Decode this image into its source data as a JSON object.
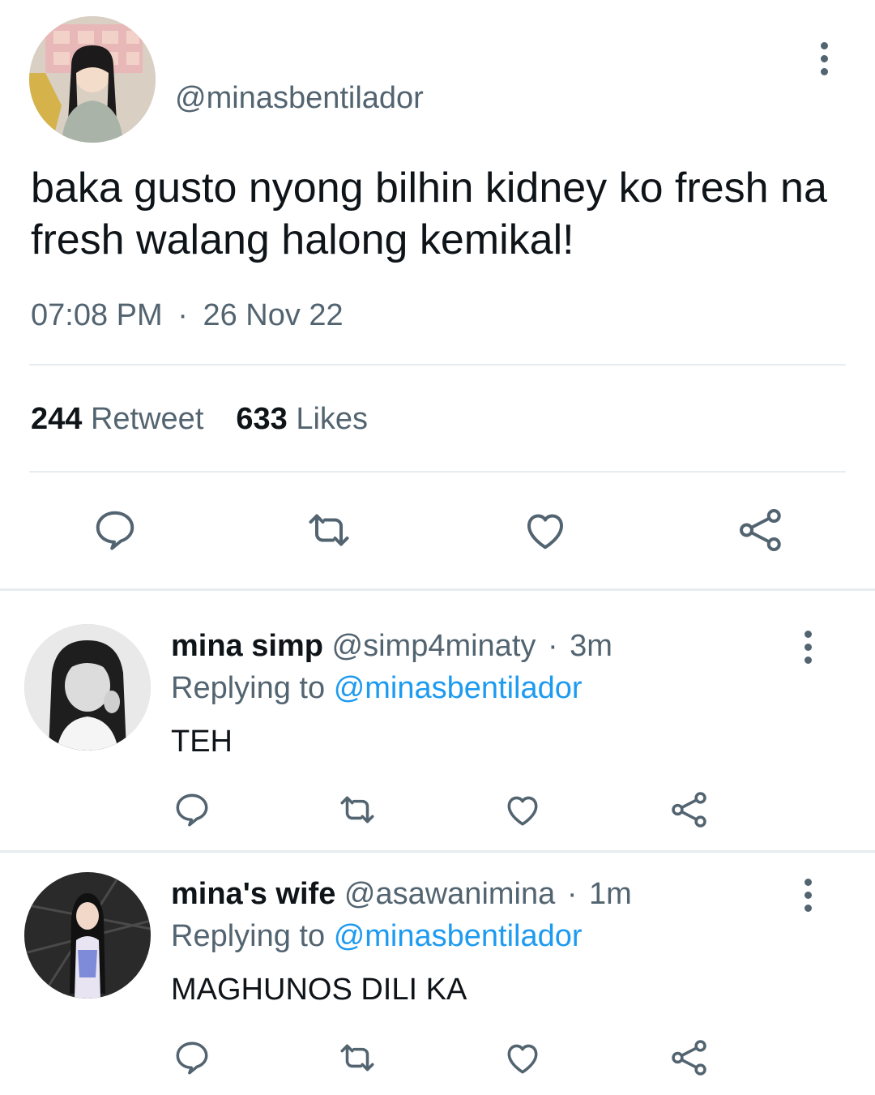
{
  "tweet": {
    "handle": "@minasbentilador",
    "text": "baka gusto nyong bilhin kidney ko fresh na fresh walang halong kemikal!",
    "time": "07:08 PM",
    "separator": "·",
    "date": "26 Nov 22",
    "retweet_count": "244",
    "retweet_label": "Retweet",
    "likes_count": "633",
    "likes_label": "Likes"
  },
  "replies": [
    {
      "name": "mina simp",
      "handle": "@simp4minaty",
      "separator": "·",
      "age": "3m",
      "replying_label": "Replying to",
      "replying_to": "@minasbentilador",
      "text": "TEH"
    },
    {
      "name": "mina's wife",
      "handle": "@asawanimina",
      "separator": "·",
      "age": "1m",
      "replying_label": "Replying to",
      "replying_to": "@minasbentilador",
      "text": "MAGHUNOS DILI KA"
    }
  ],
  "icons": {
    "action_row": [
      "reply-icon",
      "retweet-icon",
      "like-icon",
      "share-icon"
    ],
    "more": "more-vertical-icon"
  },
  "colors": {
    "text": "#0f1419",
    "secondary": "#536471",
    "link": "#1d9bf0",
    "divider": "#e6ecf0"
  }
}
